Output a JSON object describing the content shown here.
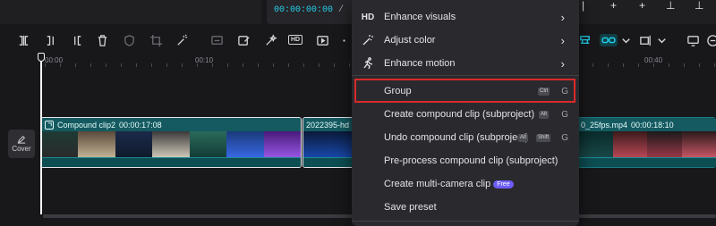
{
  "player": {
    "current_time": "00:00:00:00",
    "separator": "/"
  },
  "timeline": {
    "ruler_labels": [
      "00:00",
      "00:10",
      "00:40"
    ],
    "cover_label": "Cover",
    "clips": [
      {
        "name": "Compound clip2",
        "duration": "00:00:17:08"
      },
      {
        "name": "2022395-hd",
        "duration": ""
      },
      {
        "name": "0_25fps.mp4",
        "duration": "00:00:18:10"
      }
    ]
  },
  "context_menu": {
    "items": [
      {
        "icon": "hd-icon",
        "label": "Enhance visuals",
        "submenu": true
      },
      {
        "icon": "adjust-color-icon",
        "label": "Adjust color",
        "submenu": true
      },
      {
        "icon": "running-figure-icon",
        "label": "Enhance motion",
        "submenu": true
      },
      {
        "label": "Group",
        "key_modifier": "Ctrl",
        "key": "G",
        "highlighted": true
      },
      {
        "label": "Create compound clip (subproject)",
        "key_modifier": "Alt",
        "key": "G"
      },
      {
        "label": "Undo compound clip (subproject)",
        "key_modifier": "Alt",
        "key_modifier2": "Shift",
        "key": "G"
      },
      {
        "label": "Pre-process compound clip (subproject)"
      },
      {
        "label": "Create multi-camera clip",
        "badge": "Free"
      },
      {
        "label": "Save preset"
      }
    ]
  },
  "colors": {
    "accent": "#22d3ee",
    "highlight_border": "#d92a2a",
    "clip_teal": "#145a60",
    "free_badge": "#6d5dfc"
  }
}
